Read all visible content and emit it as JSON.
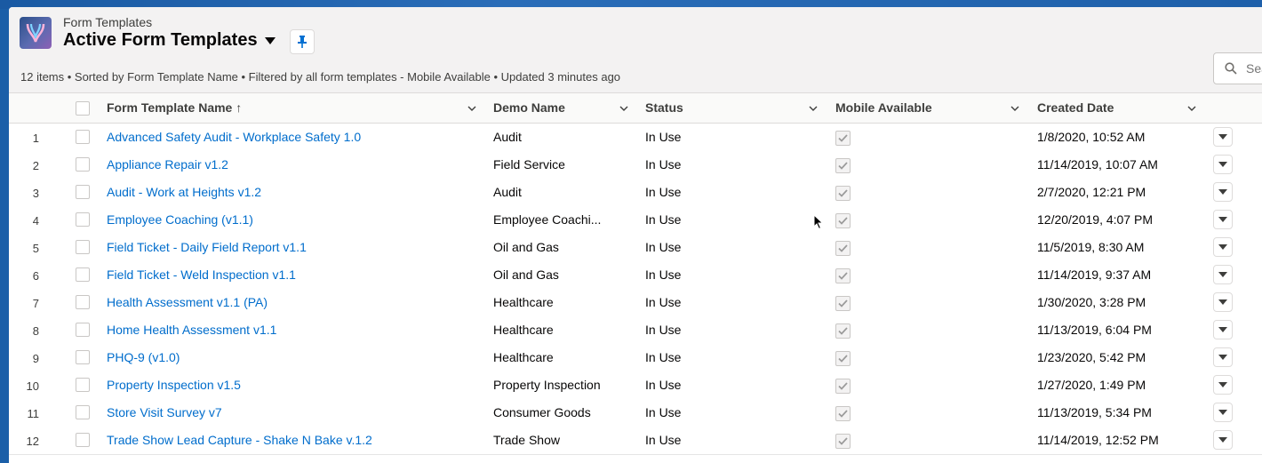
{
  "header": {
    "object_label": "Form Templates",
    "list_view_title": "Active Form Templates",
    "meta": "12 items • Sorted by Form Template Name • Filtered by all form templates - Mobile Available • Updated 3 minutes ago",
    "search_placeholder": "Search this list..."
  },
  "columns": {
    "name": "Form Template Name",
    "sort_indicator": "↑",
    "demo": "Demo Name",
    "status": "Status",
    "mobile": "Mobile Available",
    "created": "Created Date"
  },
  "rows": [
    {
      "num": "1",
      "name": "Advanced Safety Audit - Workplace Safety 1.0",
      "demo": "Audit",
      "status": "In Use",
      "mobile": true,
      "created": "1/8/2020, 10:52 AM"
    },
    {
      "num": "2",
      "name": "Appliance Repair v1.2",
      "demo": "Field Service",
      "status": "In Use",
      "mobile": true,
      "created": "11/14/2019, 10:07 AM"
    },
    {
      "num": "3",
      "name": "Audit - Work at Heights v1.2",
      "demo": "Audit",
      "status": "In Use",
      "mobile": true,
      "created": "2/7/2020, 12:21 PM"
    },
    {
      "num": "4",
      "name": "Employee Coaching (v1.1)",
      "demo": "Employee Coachi...",
      "status": "In Use",
      "mobile": true,
      "created": "12/20/2019, 4:07 PM"
    },
    {
      "num": "5",
      "name": "Field Ticket - Daily Field Report v1.1",
      "demo": "Oil and Gas",
      "status": "In Use",
      "mobile": true,
      "created": "11/5/2019, 8:30 AM"
    },
    {
      "num": "6",
      "name": "Field Ticket - Weld Inspection v1.1",
      "demo": "Oil and Gas",
      "status": "In Use",
      "mobile": true,
      "created": "11/14/2019, 9:37 AM"
    },
    {
      "num": "7",
      "name": "Health Assessment v1.1 (PA)",
      "demo": "Healthcare",
      "status": "In Use",
      "mobile": true,
      "created": "1/30/2020, 3:28 PM"
    },
    {
      "num": "8",
      "name": "Home Health Assessment v1.1",
      "demo": "Healthcare",
      "status": "In Use",
      "mobile": true,
      "created": "11/13/2019, 6:04 PM"
    },
    {
      "num": "9",
      "name": "PHQ-9 (v1.0)",
      "demo": "Healthcare",
      "status": "In Use",
      "mobile": true,
      "created": "1/23/2020, 5:42 PM"
    },
    {
      "num": "10",
      "name": "Property Inspection v1.5",
      "demo": "Property Inspection",
      "status": "In Use",
      "mobile": true,
      "created": "1/27/2020, 1:49 PM"
    },
    {
      "num": "11",
      "name": "Store Visit Survey v7",
      "demo": "Consumer Goods",
      "status": "In Use",
      "mobile": true,
      "created": "11/13/2019, 5:34 PM"
    },
    {
      "num": "12",
      "name": "Trade Show Lead Capture - Shake N Bake v.1.2",
      "demo": "Trade Show",
      "status": "In Use",
      "mobile": true,
      "created": "11/14/2019, 12:52 PM"
    }
  ],
  "colors": {
    "link": "#006dcc",
    "brand_bg": "#1b5fa8"
  },
  "icons": [
    "app-logo-icon",
    "pin-icon",
    "chevron-down-icon",
    "search-icon",
    "checkmark-icon",
    "row-action-caret-icon",
    "mouse-pointer-icon"
  ]
}
